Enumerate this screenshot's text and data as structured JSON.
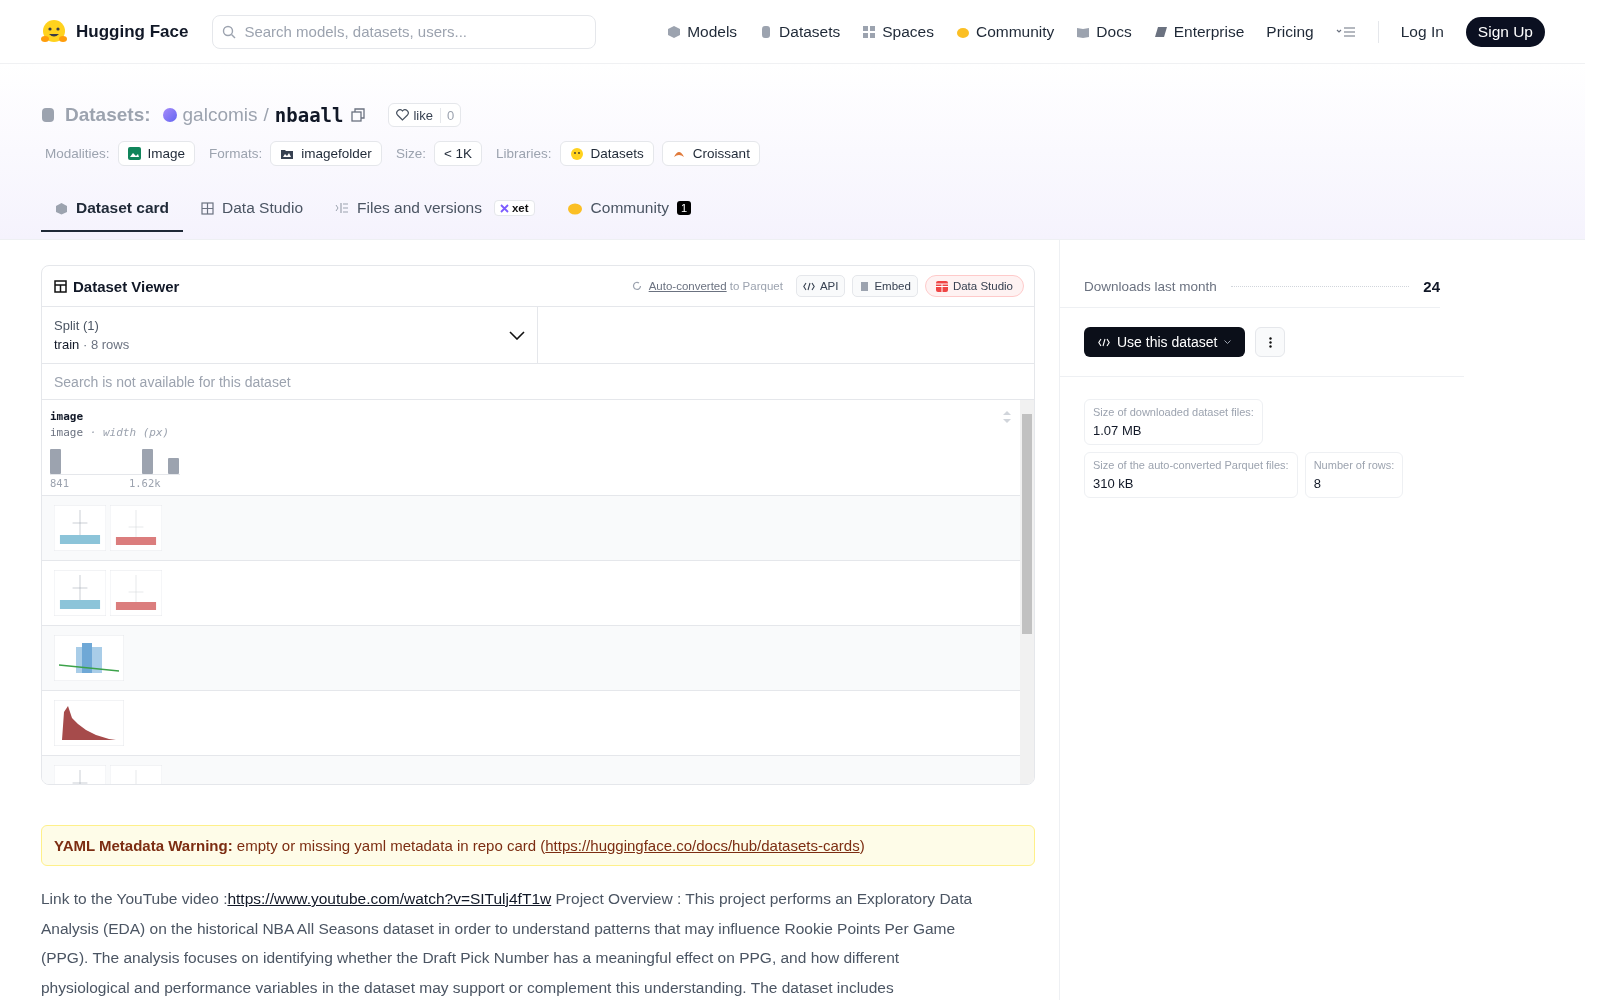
{
  "header": {
    "brand": "Hugging Face",
    "search": {
      "placeholder": "Search models, datasets, users..."
    },
    "nav": [
      {
        "label": "Models"
      },
      {
        "label": "Datasets"
      },
      {
        "label": "Spaces"
      },
      {
        "label": "Community"
      },
      {
        "label": "Docs"
      },
      {
        "label": "Enterprise"
      },
      {
        "label": "Pricing"
      }
    ],
    "login": "Log In",
    "signup": "Sign Up"
  },
  "repo": {
    "section": "Datasets:",
    "owner": "galcomis",
    "separator": "/",
    "name": "nbaall",
    "like_label": "like",
    "like_count": "0"
  },
  "tags": [
    {
      "label": "Modalities:",
      "items": [
        "Image"
      ]
    },
    {
      "label": "Formats:",
      "items": [
        "imagefolder"
      ]
    },
    {
      "label": "Size:",
      "items": [
        "< 1K"
      ]
    },
    {
      "label": "Libraries:",
      "items": [
        "Datasets",
        "Croissant"
      ]
    }
  ],
  "tabs": [
    {
      "label": "Dataset card",
      "selected": true
    },
    {
      "label": "Data Studio",
      "selected": false
    },
    {
      "label": "Files and versions",
      "selected": false,
      "badge": "xet"
    },
    {
      "label": "Community",
      "selected": false,
      "count": "1"
    }
  ],
  "viewer": {
    "title": "Dataset Viewer",
    "converted_link": "Auto-converted",
    "converted_text": "to Parquet",
    "buttons": [
      "API",
      "Embed",
      "Data Studio"
    ],
    "split": {
      "label": "Split (1)",
      "value": "train",
      "separator": "·",
      "rows": "8 rows"
    },
    "search": {
      "placeholder": "Search is not available for this dataset"
    },
    "column": {
      "name": "image",
      "type": "image",
      "stat": "· width (px)",
      "min_label": "841",
      "max_label": "1.62k"
    },
    "rows": [
      {
        "images": [
          {
            "kind": "picture"
          },
          {
            "kind": "picture"
          }
        ]
      },
      {
        "images": [
          {
            "kind": "picture"
          },
          {
            "kind": "picture"
          }
        ]
      },
      {
        "images": [
          {
            "kind": "picture"
          }
        ]
      },
      {
        "images": [
          {
            "kind": "picture"
          }
        ]
      },
      {
        "images": [
          {
            "kind": "picture"
          },
          {
            "kind": "picture"
          }
        ]
      }
    ]
  },
  "warning": {
    "label": "YAML Metadata Warning:",
    "text": "empty or missing yaml metadata in repo card (",
    "link": "https://huggingface.co/docs/hub/datasets-cards",
    "suffix": ")"
  },
  "description": {
    "prefix": "Link to the YouTube video :",
    "link": "https://www.youtube.com/watch?v=SITulj4fT1w",
    "text": " Project Overview : This project performs an Exploratory Data Analysis (EDA) on the historical NBA All Seasons dataset in order to understand patterns that may influence Rookie Points Per Game (PPG). The analysis focuses on identifying whether the Draft Pick Number has a meaningful effect on PPG, and how different physiological and performance variables in the dataset may support or complement this understanding. The dataset includes"
  },
  "sidebar": {
    "downloads_label": "Downloads last month",
    "downloads_value": "24",
    "use_button": "Use this dataset",
    "stats": [
      {
        "label": "Size of downloaded dataset files:",
        "value": "1.07 MB"
      },
      {
        "label": "Size of the auto-converted Parquet files:",
        "value": "310 kB"
      },
      {
        "label": "Number of rows:",
        "value": "8"
      }
    ]
  }
}
